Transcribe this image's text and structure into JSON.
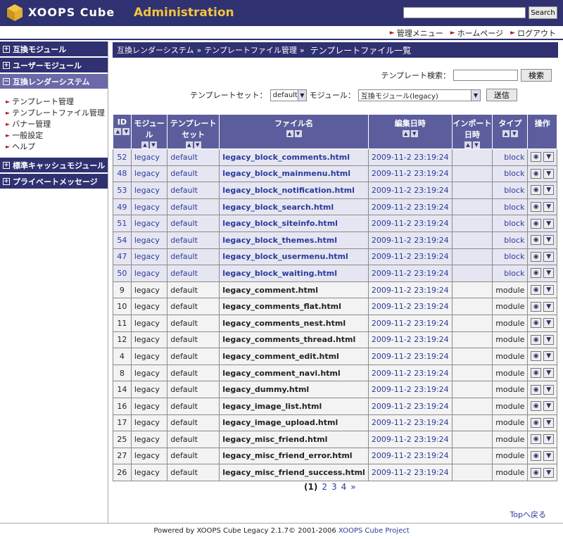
{
  "header": {
    "logo_text": "XOOPS Cube",
    "admin_text": "Administration",
    "search_button": "Search",
    "search_value": ""
  },
  "topnav": [
    "管理メニュー",
    "ホームページ",
    "ログアウト"
  ],
  "sidebar": {
    "sections": [
      {
        "label": "互換モジュール",
        "active": false
      },
      {
        "label": "ユーザーモジュール",
        "active": false
      },
      {
        "label": "互換レンダーシステム",
        "active": true
      }
    ],
    "subitems": [
      "テンプレート管理",
      "テンプレートファイル管理",
      "バナー管理",
      "一般設定",
      "ヘルプ"
    ],
    "after_sections": [
      {
        "label": "標準キャッシュモジュール"
      },
      {
        "label": "プライベートメッセージ"
      }
    ]
  },
  "breadcrumb": {
    "items": [
      "互換レンダーシステム",
      "テンプレートファイル管理"
    ],
    "separator": "»",
    "current": "テンプレートファイル一覧"
  },
  "template_search": {
    "label": "テンプレート検索：",
    "value": "",
    "button": "検索"
  },
  "filters": {
    "set_label": "テンプレートセット：",
    "set_value": "default",
    "module_label": "モジュール：",
    "module_value": "互換モジュール(legacy)",
    "submit": "送信"
  },
  "table": {
    "columns": [
      "ID",
      "モジュール",
      "テンプレートセット",
      "ファイル名",
      "編集日時",
      "インポート日時",
      "タイプ",
      "操作"
    ],
    "rows": [
      {
        "id": "52",
        "module": "legacy",
        "set": "default",
        "file": "legacy_block_comments.html",
        "date": "2009-11-2 23:19:24",
        "imported": "",
        "type": "block"
      },
      {
        "id": "48",
        "module": "legacy",
        "set": "default",
        "file": "legacy_block_mainmenu.html",
        "date": "2009-11-2 23:19:24",
        "imported": "",
        "type": "block"
      },
      {
        "id": "53",
        "module": "legacy",
        "set": "default",
        "file": "legacy_block_notification.html",
        "date": "2009-11-2 23:19:24",
        "imported": "",
        "type": "block"
      },
      {
        "id": "49",
        "module": "legacy",
        "set": "default",
        "file": "legacy_block_search.html",
        "date": "2009-11-2 23:19:24",
        "imported": "",
        "type": "block"
      },
      {
        "id": "51",
        "module": "legacy",
        "set": "default",
        "file": "legacy_block_siteinfo.html",
        "date": "2009-11-2 23:19:24",
        "imported": "",
        "type": "block"
      },
      {
        "id": "54",
        "module": "legacy",
        "set": "default",
        "file": "legacy_block_themes.html",
        "date": "2009-11-2 23:19:24",
        "imported": "",
        "type": "block"
      },
      {
        "id": "47",
        "module": "legacy",
        "set": "default",
        "file": "legacy_block_usermenu.html",
        "date": "2009-11-2 23:19:24",
        "imported": "",
        "type": "block"
      },
      {
        "id": "50",
        "module": "legacy",
        "set": "default",
        "file": "legacy_block_waiting.html",
        "date": "2009-11-2 23:19:24",
        "imported": "",
        "type": "block"
      },
      {
        "id": "9",
        "module": "legacy",
        "set": "default",
        "file": "legacy_comment.html",
        "date": "2009-11-2 23:19:24",
        "imported": "",
        "type": "module"
      },
      {
        "id": "10",
        "module": "legacy",
        "set": "default",
        "file": "legacy_comments_flat.html",
        "date": "2009-11-2 23:19:24",
        "imported": "",
        "type": "module"
      },
      {
        "id": "11",
        "module": "legacy",
        "set": "default",
        "file": "legacy_comments_nest.html",
        "date": "2009-11-2 23:19:24",
        "imported": "",
        "type": "module"
      },
      {
        "id": "12",
        "module": "legacy",
        "set": "default",
        "file": "legacy_comments_thread.html",
        "date": "2009-11-2 23:19:24",
        "imported": "",
        "type": "module"
      },
      {
        "id": "4",
        "module": "legacy",
        "set": "default",
        "file": "legacy_comment_edit.html",
        "date": "2009-11-2 23:19:24",
        "imported": "",
        "type": "module"
      },
      {
        "id": "8",
        "module": "legacy",
        "set": "default",
        "file": "legacy_comment_navi.html",
        "date": "2009-11-2 23:19:24",
        "imported": "",
        "type": "module"
      },
      {
        "id": "14",
        "module": "legacy",
        "set": "default",
        "file": "legacy_dummy.html",
        "date": "2009-11-2 23:19:24",
        "imported": "",
        "type": "module"
      },
      {
        "id": "16",
        "module": "legacy",
        "set": "default",
        "file": "legacy_image_list.html",
        "date": "2009-11-2 23:19:24",
        "imported": "",
        "type": "module"
      },
      {
        "id": "17",
        "module": "legacy",
        "set": "default",
        "file": "legacy_image_upload.html",
        "date": "2009-11-2 23:19:24",
        "imported": "",
        "type": "module"
      },
      {
        "id": "25",
        "module": "legacy",
        "set": "default",
        "file": "legacy_misc_friend.html",
        "date": "2009-11-2 23:19:24",
        "imported": "",
        "type": "module"
      },
      {
        "id": "27",
        "module": "legacy",
        "set": "default",
        "file": "legacy_misc_friend_error.html",
        "date": "2009-11-2 23:19:24",
        "imported": "",
        "type": "module"
      },
      {
        "id": "26",
        "module": "legacy",
        "set": "default",
        "file": "legacy_misc_friend_success.html",
        "date": "2009-11-2 23:19:24",
        "imported": "",
        "type": "module"
      }
    ]
  },
  "pager": {
    "current": "(1)",
    "pages": [
      "2",
      "3",
      "4"
    ],
    "next": "»"
  },
  "top_link": "Topへ戻る",
  "footer": {
    "text": "Powered by XOOPS Cube Legacy 2.1.7© 2001-2006",
    "project": "XOOPS Cube Project"
  },
  "colors": {
    "header_bg": "#2f3170",
    "accent": "#f2c440",
    "table_head": "#5b5d9d"
  }
}
